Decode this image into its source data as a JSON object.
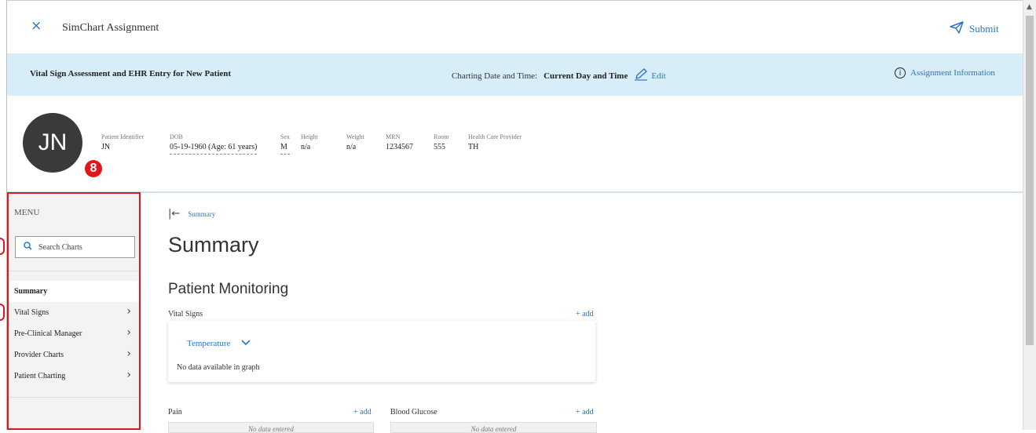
{
  "topbar": {
    "close_icon": "×",
    "title": "SimChart Assignment",
    "submit_label": "Submit"
  },
  "infobar": {
    "assignment_title": "Vital Sign Assessment and EHR Entry for New Patient",
    "charting_label": "Charting Date and Time:",
    "charting_value": "Current Day and Time",
    "edit_label": "Edit",
    "assignment_info_label": "Assignment Information",
    "info_icon": "i"
  },
  "patient": {
    "initials": "JN",
    "annotation_badge": "8",
    "fields": [
      {
        "label": "Patient Identifier",
        "value": "JN"
      },
      {
        "label": "DOB",
        "value": "05-19-1960 (Age: 61 years)"
      },
      {
        "label": "Sex",
        "value": "M"
      },
      {
        "label": "Height",
        "value": "n/a"
      },
      {
        "label": "Weight",
        "value": "n/a"
      },
      {
        "label": "MRN",
        "value": "1234567"
      },
      {
        "label": "Room",
        "value": "555"
      },
      {
        "label": "Health Care Provider",
        "value": "TH"
      }
    ]
  },
  "menu": {
    "title": "MENU",
    "search_placeholder": "Search Charts",
    "items": [
      {
        "label": "Summary",
        "active": true
      },
      {
        "label": "Vital Signs"
      },
      {
        "label": "Pre-Clinical Manager"
      },
      {
        "label": "Provider Charts"
      },
      {
        "label": "Patient Charting"
      }
    ],
    "chevron": "›"
  },
  "main": {
    "breadcrumb_arrow": "|←",
    "breadcrumb": "Summary",
    "page_title": "Summary",
    "section_title": "Patient Monitoring",
    "vital_signs_label": "Vital Signs",
    "add_label": "+ add",
    "temperature_select": "Temperature",
    "no_data_graph": "No data available in graph",
    "pain_label": "Pain",
    "blood_glucose_label": "Blood Glucose",
    "no_data_entered": "No data entered"
  },
  "colors": {
    "accent": "#2a74c8",
    "infobar_bg": "#d7edf7",
    "annotation_red": "#e0161c"
  }
}
